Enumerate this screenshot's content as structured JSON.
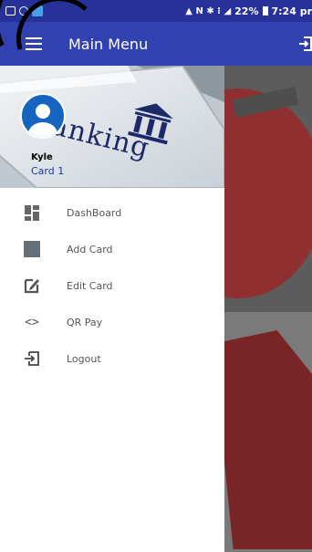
{
  "status_bar": {
    "battery_percent": "22%",
    "time": "7:24 pr",
    "signal_glyphs": "▲ N ✱ ⁝ ◢"
  },
  "app_bar": {
    "title": "Main Menu"
  },
  "drawer": {
    "banner_text": "-Banking",
    "user": {
      "name": "Kyle",
      "card": "Card 1"
    },
    "items": [
      {
        "label": "DashBoard",
        "icon": "dashboard-icon"
      },
      {
        "label": "Add Card",
        "icon": "add-card-icon"
      },
      {
        "label": "Edit Card",
        "icon": "edit-icon"
      },
      {
        "label": "QR Pay",
        "icon": "code-icon"
      },
      {
        "label": "Logout",
        "icon": "logout-icon"
      }
    ]
  },
  "colors": {
    "status_bar": "#26319a",
    "app_bar": "#3241b1",
    "avatar": "#1565c0",
    "card_label": "#1e38a8",
    "scrim": "#5c5c5c"
  }
}
